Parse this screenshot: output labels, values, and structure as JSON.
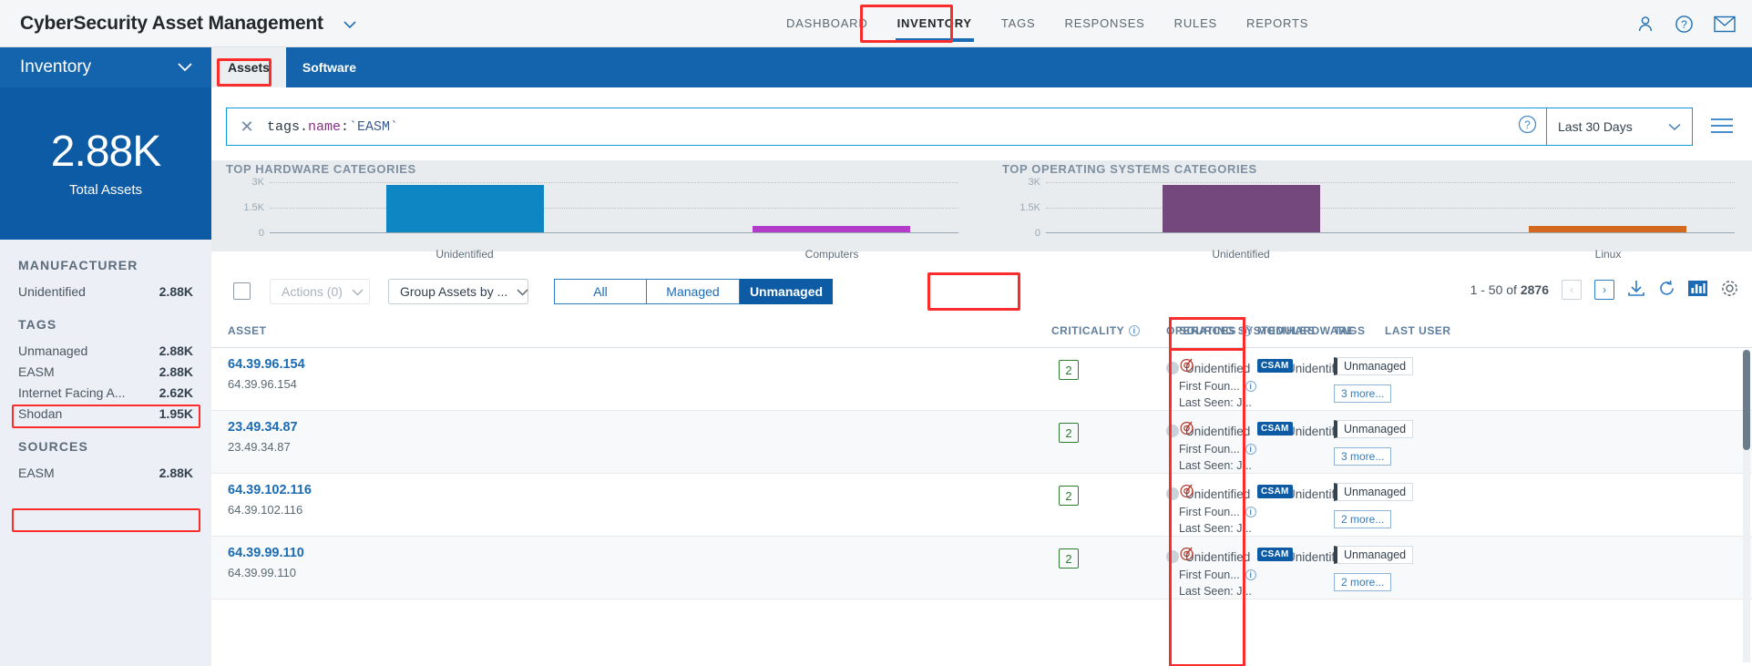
{
  "header": {
    "brand": "CyberSecurity Asset Management",
    "brand_caret": "⌄",
    "nav": [
      {
        "label": "DASHBOARD",
        "active": false
      },
      {
        "label": "INVENTORY",
        "active": true
      },
      {
        "label": "TAGS",
        "active": false
      },
      {
        "label": "RESPONSES",
        "active": false
      },
      {
        "label": "RULES",
        "active": false
      },
      {
        "label": "REPORTS",
        "active": false
      }
    ],
    "icons": [
      "user-icon",
      "help-icon",
      "mail-icon"
    ]
  },
  "subbar": {
    "title": "Inventory",
    "caret": "⌄",
    "tabs": [
      {
        "label": "Assets",
        "active": true
      },
      {
        "label": "Software",
        "active": false
      }
    ]
  },
  "kpi": {
    "value": "2.88K",
    "label": "Total Assets"
  },
  "facets": [
    {
      "title": "MANUFACTURER",
      "rows": [
        {
          "label": "Unidentified",
          "value": "2.88K",
          "highlight": false
        }
      ]
    },
    {
      "title": "TAGS",
      "rows": [
        {
          "label": "Unmanaged",
          "value": "2.88K",
          "highlight": false
        },
        {
          "label": "EASM",
          "value": "2.88K",
          "highlight": true
        },
        {
          "label": "Internet Facing A...",
          "value": "2.62K",
          "highlight": false
        },
        {
          "label": "Shodan",
          "value": "1.95K",
          "highlight": false
        }
      ]
    },
    {
      "title": "SOURCES",
      "rows": [
        {
          "label": "EASM",
          "value": "2.88K",
          "highlight": true
        }
      ]
    }
  ],
  "search": {
    "clear_icon": "✕",
    "query_prefix": "tags.",
    "query_key": "name",
    "query_sep": ":",
    "query_value": "`EASM`",
    "full_query": "tags.name:`EASM`",
    "help_icon": "?",
    "date_range": "Last 30 Days",
    "date_caret": "⌄",
    "menu_icon": "hamburger-icon"
  },
  "chart_data": [
    {
      "type": "bar",
      "title": "TOP HARDWARE CATEGORIES",
      "categories": [
        "Unidentified",
        "Computers"
      ],
      "values": [
        2800,
        140
      ],
      "colors": [
        "#0e86c4",
        "#b23bc9"
      ],
      "ylim": [
        0,
        3000
      ],
      "yticks": [
        "0",
        "1.5K",
        "3K"
      ],
      "ytick_values": [
        0,
        1500,
        3000
      ],
      "grid": true,
      "xlabel": "",
      "ylabel": ""
    },
    {
      "type": "bar",
      "title": "TOP OPERATING SYSTEMS CATEGORIES",
      "categories": [
        "Unidentified",
        "Linux"
      ],
      "values": [
        2800,
        140
      ],
      "colors": [
        "#74487c",
        "#d2691e"
      ],
      "ylim": [
        0,
        3000
      ],
      "yticks": [
        "0",
        "1.5K",
        "3K"
      ],
      "ytick_values": [
        0,
        1500,
        3000
      ],
      "grid": true,
      "xlabel": "",
      "ylabel": ""
    }
  ],
  "toolbar": {
    "actions_label": "Actions (0)",
    "actions_caret": "⌄",
    "group_label": "Group Assets by ...",
    "group_caret": "⌄",
    "segments": [
      {
        "label": "All",
        "selected": false
      },
      {
        "label": "Managed",
        "selected": false
      },
      {
        "label": "Unmanaged",
        "selected": true
      }
    ],
    "pager_text_prefix": "1 - 50 of ",
    "pager_total": "2876",
    "prev_icon": "‹",
    "next_icon": "›",
    "download_icon": "download-icon",
    "refresh_icon": "refresh-icon",
    "chart_icon": "chart-icon",
    "settings_icon": "gear-icon"
  },
  "table": {
    "columns": [
      {
        "label": "ASSET",
        "info": false
      },
      {
        "label": "CRITICALITY",
        "info": true
      },
      {
        "label": "OPERATING SYSTEM",
        "info": false
      },
      {
        "label": "HARDWARE",
        "info": false
      },
      {
        "label": "LAST USER",
        "info": false
      },
      {
        "label": "SOURCES",
        "info": true
      },
      {
        "label": "MODULES",
        "info": false
      },
      {
        "label": "TAGS",
        "info": false
      }
    ],
    "rows": [
      {
        "asset": "64.39.96.154",
        "asset_sub": "64.39.96.154",
        "criticality": "2",
        "operating_system": "Unidentified",
        "hardware": "Unidentified",
        "last_user": "-",
        "sources_first": "First Foun...",
        "sources_last": "Last Seen: J...",
        "modules": "CSAM",
        "tag": "Unmanaged",
        "tag_more": "3 more..."
      },
      {
        "asset": "23.49.34.87",
        "asset_sub": "23.49.34.87",
        "criticality": "2",
        "operating_system": "Unidentified",
        "hardware": "Unidentified",
        "last_user": "-",
        "sources_first": "First Foun...",
        "sources_last": "Last Seen: J...",
        "modules": "CSAM",
        "tag": "Unmanaged",
        "tag_more": "3 more..."
      },
      {
        "asset": "64.39.102.116",
        "asset_sub": "64.39.102.116",
        "criticality": "2",
        "operating_system": "Unidentified",
        "hardware": "Unidentified",
        "last_user": "-",
        "sources_first": "First Foun...",
        "sources_last": "Last Seen: J...",
        "modules": "CSAM",
        "tag": "Unmanaged",
        "tag_more": "2 more..."
      },
      {
        "asset": "64.39.99.110",
        "asset_sub": "64.39.99.110",
        "criticality": "2",
        "operating_system": "Unidentified",
        "hardware": "Unidentified",
        "last_user": "-",
        "sources_first": "First Foun...",
        "sources_last": "Last Seen: J...",
        "modules": "CSAM",
        "tag": "Unmanaged",
        "tag_more": "2 more..."
      }
    ]
  },
  "colors": {
    "brand_blue": "#1364ad",
    "kpi_blue": "#0d5ba4",
    "accent_blue": "#1b6cb5",
    "highlight_red": "#fb2c2c",
    "bar_hw_1": "#0e86c4",
    "bar_hw_2": "#b23bc9",
    "bar_os_1": "#74487c",
    "bar_os_2": "#d2691e"
  }
}
